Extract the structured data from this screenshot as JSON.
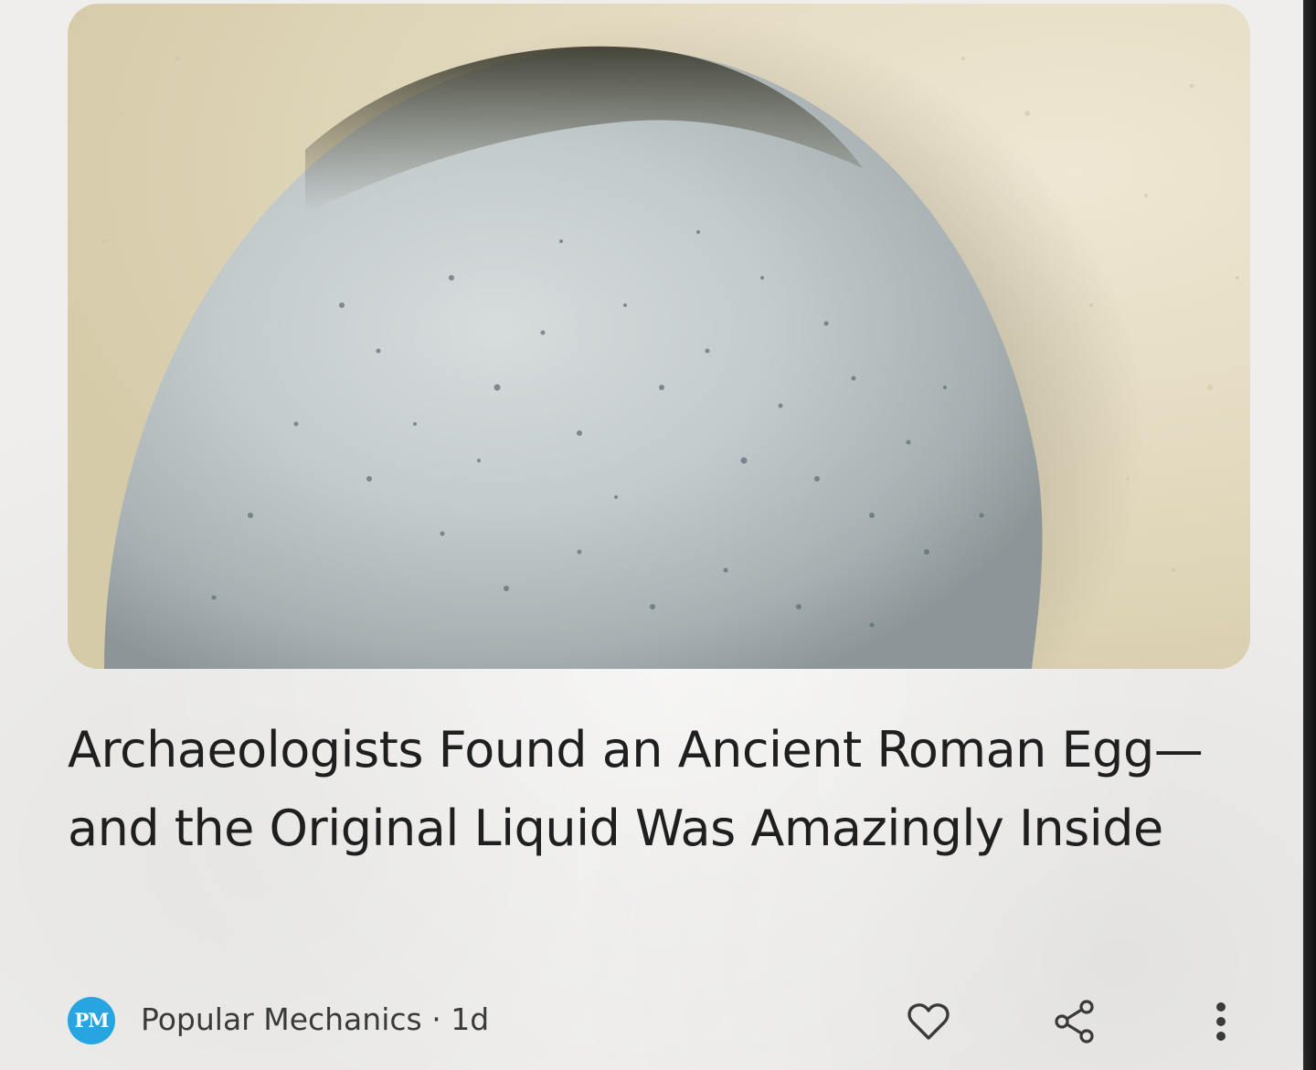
{
  "article": {
    "image_alt": "Speckled grey ancient egg resting in pale sand",
    "headline": "Archaeologists Found an Ancient Roman Egg—and the Original Liquid Was Amazingly Inside",
    "publisher": {
      "logo_text": "PM",
      "name": "Popular Mechanics",
      "age": "1d",
      "separator": "·",
      "logo_color": "#27a5e0"
    },
    "actions": {
      "like_icon": "heart-icon",
      "share_icon": "share-icon",
      "more_icon": "more-vert-icon"
    }
  },
  "colors": {
    "page_background": "#efeeec",
    "headline_text": "#1f1f1f",
    "meta_text": "#3a3a3a"
  }
}
